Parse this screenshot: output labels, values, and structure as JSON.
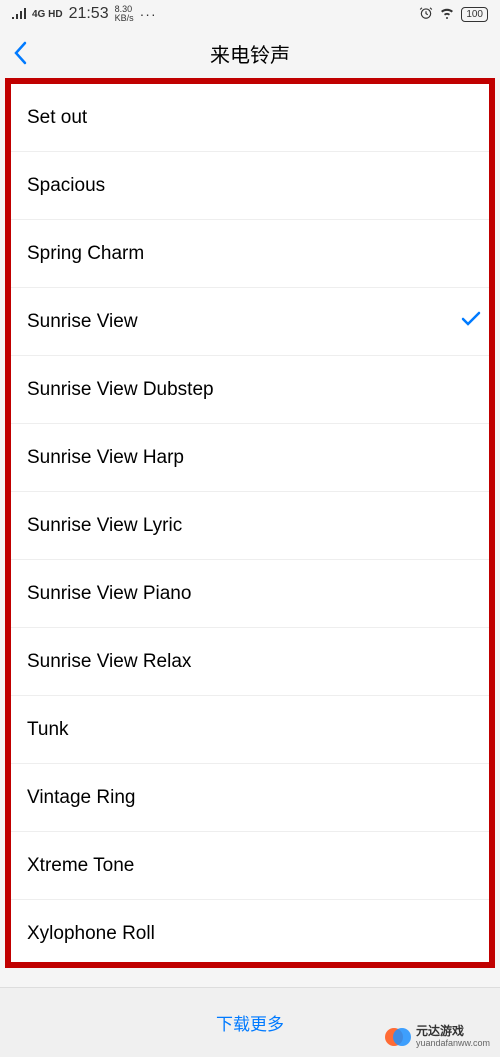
{
  "statusBar": {
    "network": "4G HD",
    "time": "21:53",
    "speed": "8.30",
    "speedUnit": "KB/s",
    "dots": "···",
    "battery": "100"
  },
  "nav": {
    "title": "来电铃声"
  },
  "ringtones": [
    {
      "name": "Set out",
      "selected": false
    },
    {
      "name": "Spacious",
      "selected": false
    },
    {
      "name": "Spring Charm",
      "selected": false
    },
    {
      "name": "Sunrise View",
      "selected": true
    },
    {
      "name": "Sunrise View Dubstep",
      "selected": false
    },
    {
      "name": "Sunrise View Harp",
      "selected": false
    },
    {
      "name": "Sunrise View Lyric",
      "selected": false
    },
    {
      "name": "Sunrise View Piano",
      "selected": false
    },
    {
      "name": "Sunrise View Relax",
      "selected": false
    },
    {
      "name": "Tunk",
      "selected": false
    },
    {
      "name": "Vintage Ring",
      "selected": false
    },
    {
      "name": "Xtreme Tone",
      "selected": false
    },
    {
      "name": "Xylophone Roll",
      "selected": false
    }
  ],
  "bottom": {
    "downloadMore": "下载更多"
  },
  "watermark": {
    "title": "元达游戏",
    "url": "yuandafanww.com"
  }
}
